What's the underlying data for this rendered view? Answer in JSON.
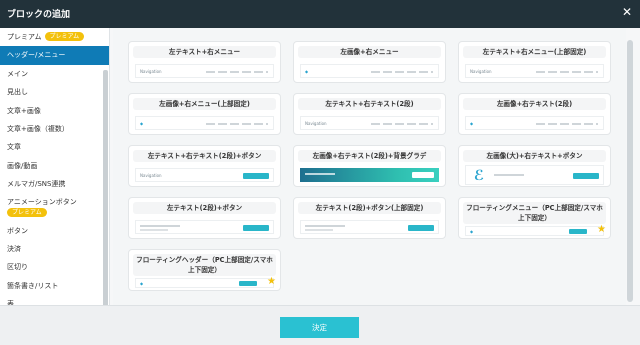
{
  "dialog": {
    "title": "ブロックの追加",
    "close_label": "✕"
  },
  "sidebar": {
    "items": [
      {
        "label": "プレミアム",
        "badge": "プレミアム"
      },
      {
        "label": "ヘッダー/メニュー",
        "badge": ""
      },
      {
        "label": "メイン",
        "badge": ""
      },
      {
        "label": "見出し",
        "badge": ""
      },
      {
        "label": "文章+画像",
        "badge": ""
      },
      {
        "label": "文章+画像（複数）",
        "badge": ""
      },
      {
        "label": "文章",
        "badge": ""
      },
      {
        "label": "画像/動画",
        "badge": ""
      },
      {
        "label": "メルマガ/SNS連携",
        "badge": ""
      },
      {
        "label": "アニメーションボタン",
        "badge": "プレミアム"
      },
      {
        "label": "ボタン",
        "badge": ""
      },
      {
        "label": "決済",
        "badge": ""
      },
      {
        "label": "区切り",
        "badge": ""
      },
      {
        "label": "箇条書き/リスト",
        "badge": ""
      },
      {
        "label": "表",
        "badge": ""
      }
    ],
    "active_index": 1
  },
  "blocks": [
    {
      "title": "左テキスト+右メニュー",
      "logo": "Navigation",
      "premium": false
    },
    {
      "title": "左画像+右メニュー",
      "logo": "",
      "premium": false
    },
    {
      "title": "左テキスト+右メニュー(上部固定)",
      "logo": "Navigation",
      "premium": false
    },
    {
      "title": "左画像+右メニュー(上部固定)",
      "logo": "",
      "premium": false
    },
    {
      "title": "左テキスト+右テキスト(2段)",
      "logo": "Navigation",
      "premium": false
    },
    {
      "title": "左画像+右テキスト(2段)",
      "logo": "",
      "premium": false
    },
    {
      "title": "左テキスト+右テキスト(2段)+ボタン",
      "logo": "Navigation",
      "premium": false
    },
    {
      "title": "左画像+右テキスト(2段)+背景グラデ",
      "logo": "",
      "premium": false
    },
    {
      "title": "左画像(大)+右テキスト+ボタン",
      "logo": "",
      "premium": false
    },
    {
      "title": "左テキスト(2段)+ボタン",
      "logo": "",
      "premium": false
    },
    {
      "title": "左テキスト(2段)+ボタン(上部固定)",
      "logo": "",
      "premium": false
    },
    {
      "title": "フローティングメニュー（PC上部固定/スマホ上下固定）",
      "logo": "",
      "premium": true
    },
    {
      "title": "フローティングヘッダー（PC上部固定/スマホ上下固定）",
      "logo": "",
      "premium": true
    }
  ],
  "footer": {
    "confirm_label": "決定"
  },
  "colors": {
    "header_bg": "#22323a",
    "active": "#0f7bb6",
    "badge": "#f3c10c",
    "button": "#2ac1d2"
  },
  "icons": {
    "close": "close-icon",
    "premium": "star-icon"
  }
}
